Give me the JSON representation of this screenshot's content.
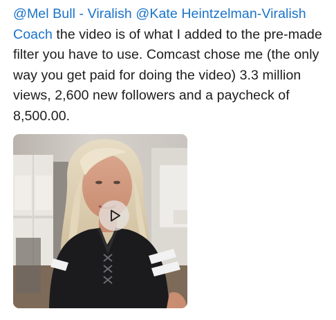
{
  "post": {
    "mention_1": "@Mel Bull - Viralish",
    "mention_2": "@Kate Heintzelman-Viralish Coach",
    "body": "the video is of what I added to the pre-made filter you have to use. Comcast chose me (the only way you get paid for doing the video) 3.3 million views, 2,600 new followers and a paycheck of 8,500.00."
  },
  "media": {
    "type": "video",
    "play_icon": "play-icon"
  },
  "colors": {
    "mention": "#1a73c9",
    "text": "#1c1c1c",
    "background": "#ffffff"
  }
}
